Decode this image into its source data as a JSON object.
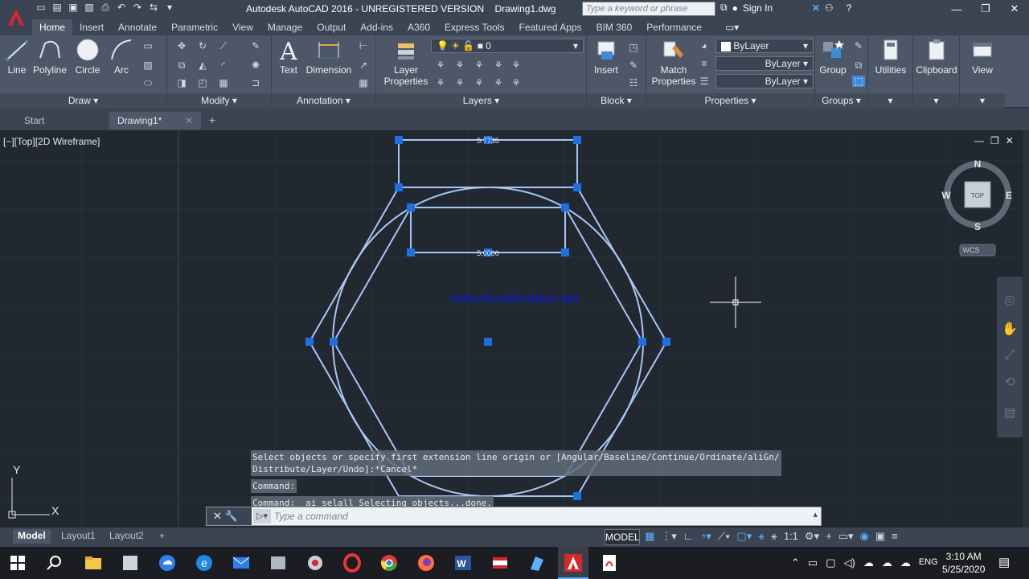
{
  "window": {
    "title": "Autodesk AutoCAD 2016 - UNREGISTERED VERSION    Drawing1.dwg",
    "search_placeholder": "Type a keyword or phrase",
    "sign_in": "Sign In"
  },
  "ribbon_tabs": [
    "Home",
    "Insert",
    "Annotate",
    "Parametric",
    "View",
    "Manage",
    "Output",
    "Add-ins",
    "A360",
    "Express Tools",
    "Featured Apps",
    "BIM 360",
    "Performance"
  ],
  "ribbon": {
    "draw": {
      "title": "Draw",
      "line": "Line",
      "polyline": "Polyline",
      "circle": "Circle",
      "arc": "Arc"
    },
    "modify": {
      "title": "Modify"
    },
    "annotation": {
      "title": "Annotation",
      "text": "Text",
      "dimension": "Dimension"
    },
    "layers": {
      "title": "Layers",
      "layer_properties": "Layer\nProperties",
      "current_layer": "0"
    },
    "block": {
      "title": "Block",
      "insert": "Insert"
    },
    "properties": {
      "title": "Properties",
      "match": "Match\nProperties",
      "color": "ByLayer",
      "linetype": "ByLayer",
      "lineweight": "ByLayer"
    },
    "groups": {
      "title": "Groups",
      "group": "Group"
    },
    "utilities": {
      "label": "Utilities"
    },
    "clipboard": {
      "label": "Clipboard"
    },
    "view": {
      "label": "View"
    }
  },
  "doc_tabs": {
    "start": "Start",
    "drawing": "Drawing1*"
  },
  "viewport": {
    "label": "[−][Top][2D Wireframe]",
    "dim_top": "5.7735",
    "dim_inner": "5.0000",
    "watermark": "www.thundershare.net",
    "viewcube": {
      "top": "TOP",
      "n": "N",
      "s": "S",
      "e": "E",
      "w": "W",
      "wcs": "WCS"
    },
    "ucs": {
      "x": "X",
      "y": "Y"
    }
  },
  "command": {
    "history": [
      "Select objects or specify first extension line origin or [Angular/Baseline/Continue/Ordinate/aliGn/\nDistribute/Layer/Undo]:*Cancel*",
      "Command:",
      "Command: _ai_selall Selecting objects...done."
    ],
    "placeholder": "Type a command"
  },
  "status": {
    "model_tab": "Model",
    "layout1": "Layout1",
    "layout2": "Layout2",
    "model_button": "MODEL",
    "scale": "1:1"
  },
  "taskbar": {
    "lang": "ENG",
    "time": "3:10 AM",
    "date": "5/25/2020"
  },
  "colors": {
    "accent": "#3c8dd9",
    "entity": "#a8c6f5",
    "grip": "#1e6fe0",
    "watermark": "#0a1ae0"
  }
}
